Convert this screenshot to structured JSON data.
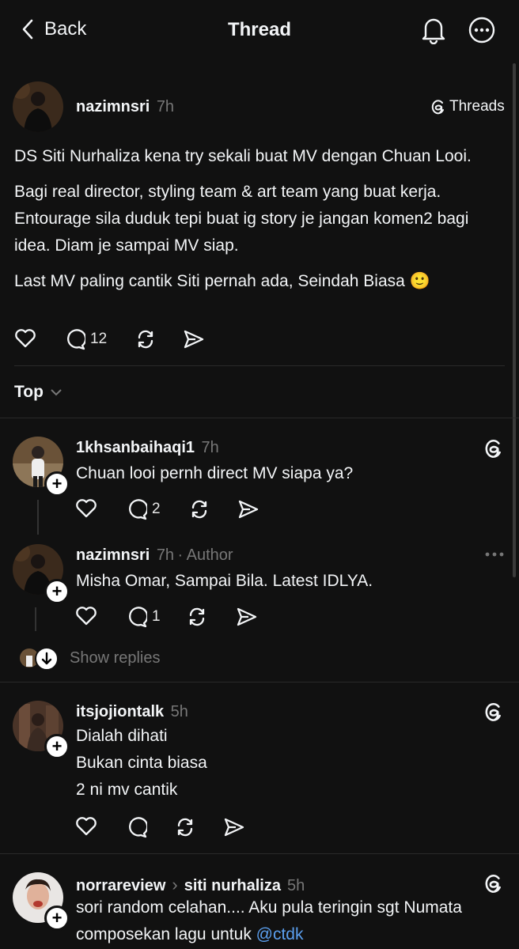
{
  "header": {
    "back_label": "Back",
    "title": "Thread"
  },
  "post": {
    "username": "nazimnsri",
    "time": "7h",
    "app_badge": "Threads",
    "paragraphs": [
      "DS Siti Nurhaliza kena try sekali buat MV dengan Chuan Looi.",
      "Bagi real director, styling team & art team yang buat kerja. Entourage sila duduk tepi buat ig story je jangan komen2 bagi idea. Diam je sampai MV siap.",
      "Last MV paling cantik Siti pernah ada, Seindah Biasa 🙂"
    ],
    "reply_count": "12"
  },
  "sort": {
    "label": "Top"
  },
  "comments": [
    {
      "username": "1khsanbaihaqi1",
      "time": "7h",
      "text": "Chuan looi pernh direct MV siapa ya?",
      "reply_count": "2"
    },
    {
      "username": "nazimnsri",
      "time": "7h",
      "author_tag": "· Author",
      "text": "Misha Omar, Sampai Bila. Latest IDLYA.",
      "reply_count": "1"
    },
    {
      "show_replies": "Show replies"
    },
    {
      "username": "itsjojiontalk",
      "time": "5h",
      "lines": [
        "Dialah dihati",
        "Bukan cinta biasa",
        "2 ni mv cantik"
      ]
    },
    {
      "username": "norrareview",
      "separator": "›",
      "target": "siti nurhaliza",
      "time": "5h",
      "line1": "sori random celahan.... Aku pula teringin sgt Numata",
      "line2": "composekan lagu untuk",
      "mention": "@ctdk"
    }
  ],
  "icons": [
    "back-chevron-icon",
    "bell-icon",
    "more-icon",
    "threads-logo-icon",
    "heart-icon",
    "comment-icon",
    "repost-icon",
    "share-icon",
    "chevron-down-icon",
    "plus-icon"
  ]
}
